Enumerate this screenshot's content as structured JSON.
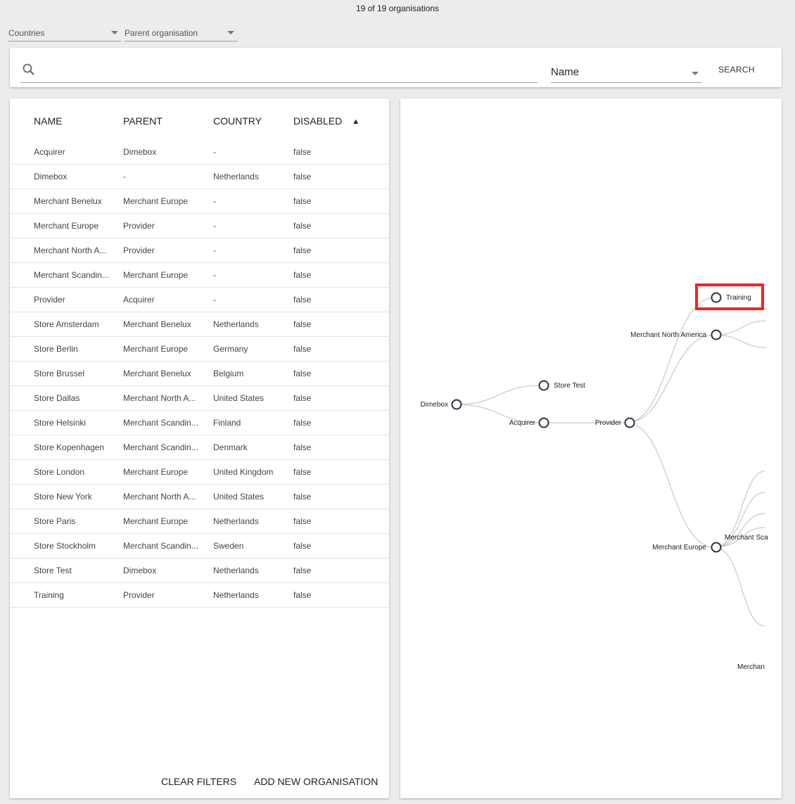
{
  "header": {
    "count_text": "19 of 19 organisations"
  },
  "filters": {
    "countries_label": "Countries",
    "parent_label": "Parent organisation"
  },
  "search": {
    "field_select_value": "Name",
    "search_button": "SEARCH"
  },
  "table": {
    "columns": [
      "NAME",
      "PARENT",
      "COUNTRY",
      "DISABLED"
    ],
    "rows": [
      [
        "Acquirer",
        "Dimebox",
        "-",
        "false"
      ],
      [
        "Dimebox",
        "-",
        "Netherlands",
        "false"
      ],
      [
        "Merchant Benelux",
        "Merchant Europe",
        "-",
        "false"
      ],
      [
        "Merchant Europe",
        "Provider",
        "-",
        "false"
      ],
      [
        "Merchant North A...",
        "Provider",
        "-",
        "false"
      ],
      [
        "Merchant Scandin...",
        "Merchant Europe",
        "-",
        "false"
      ],
      [
        "Provider",
        "Acquirer",
        "-",
        "false"
      ],
      [
        "Store Amsterdam",
        "Merchant Benelux",
        "Netherlands",
        "false"
      ],
      [
        "Store Berlin",
        "Merchant Europe",
        "Germany",
        "false"
      ],
      [
        "Store Brussel",
        "Merchant Benelux",
        "Belgium",
        "false"
      ],
      [
        "Store Dallas",
        "Merchant North A...",
        "United States",
        "false"
      ],
      [
        "Store Helsinki",
        "Merchant Scandin...",
        "Finland",
        "false"
      ],
      [
        "Store Kopenhagen",
        "Merchant Scandin...",
        "Denmark",
        "false"
      ],
      [
        "Store London",
        "Merchant Europe",
        "United Kingdom",
        "false"
      ],
      [
        "Store New York",
        "Merchant North A...",
        "United States",
        "false"
      ],
      [
        "Store Paris",
        "Merchant Europe",
        "Netherlands",
        "false"
      ],
      [
        "Store Stockholm",
        "Merchant Scandin...",
        "Sweden",
        "false"
      ],
      [
        "Store Test",
        "Dimebox",
        "Netherlands",
        "false"
      ],
      [
        "Training",
        "Provider",
        "Netherlands",
        "false"
      ]
    ],
    "clear_filters": "CLEAR FILTERS",
    "add_new": "ADD NEW ORGANISATION"
  },
  "tree": {
    "nodes": {
      "dimebox": "Dimebox",
      "store_test": "Store Test",
      "acquirer": "Acquirer",
      "provider": "Provider",
      "training": "Training",
      "merchant_north_america": "Merchant North America",
      "merchant_europe": "Merchant Europe",
      "merchant_scandinavia_partial": "Merchant Sca",
      "merchant_partial": "Merchan"
    },
    "highlight_color": "#ff1f1f"
  }
}
